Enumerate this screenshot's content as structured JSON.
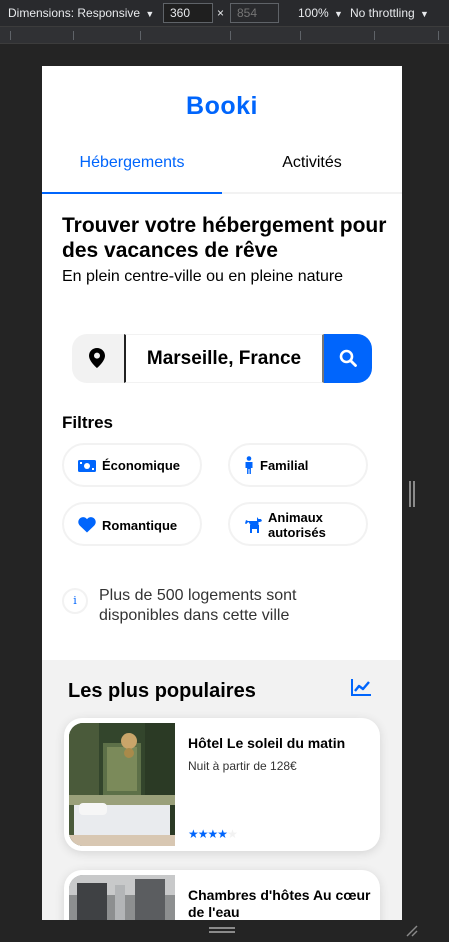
{
  "devtools": {
    "dimensions_label": "Dimensions: Responsive",
    "width_value": "360",
    "height_placeholder": "854",
    "times": "×",
    "zoom": "100%",
    "throttling": "No throttling"
  },
  "site": {
    "logo": "Booki",
    "brand_color": "#0065fc",
    "tabs": [
      {
        "label": "Hébergements",
        "active": true
      },
      {
        "label": "Activités",
        "active": false
      }
    ]
  },
  "hero": {
    "title": "Trouver votre hébergement pour des vacances de rêve",
    "subtitle": "En plein centre-ville ou en pleine nature"
  },
  "search": {
    "value": "Marseille, France",
    "pin_icon": "location-pin-icon",
    "button_icon": "search-icon"
  },
  "filters": {
    "title": "Filtres",
    "chips": [
      {
        "label": "Économique",
        "icon": "money-icon"
      },
      {
        "label": "Familial",
        "icon": "person-icon"
      },
      {
        "label": "Romantique",
        "icon": "heart-icon"
      },
      {
        "label": "Animaux autorisés",
        "icon": "dog-icon"
      }
    ]
  },
  "info": {
    "icon": "info-icon",
    "icon_glyph": "i",
    "text": "Plus de 500 logements sont disponibles dans cette ville"
  },
  "popular": {
    "title": "Les plus populaires",
    "icon": "chart-line-icon",
    "cards": [
      {
        "name": "Hôtel Le soleil du matin",
        "price": "Nuit à partir de 128€",
        "rating": 4,
        "rating_max": 5
      },
      {
        "name": "Chambres d'hôtes Au cœur de l'eau",
        "price": "",
        "rating": null,
        "rating_max": 5
      }
    ]
  }
}
